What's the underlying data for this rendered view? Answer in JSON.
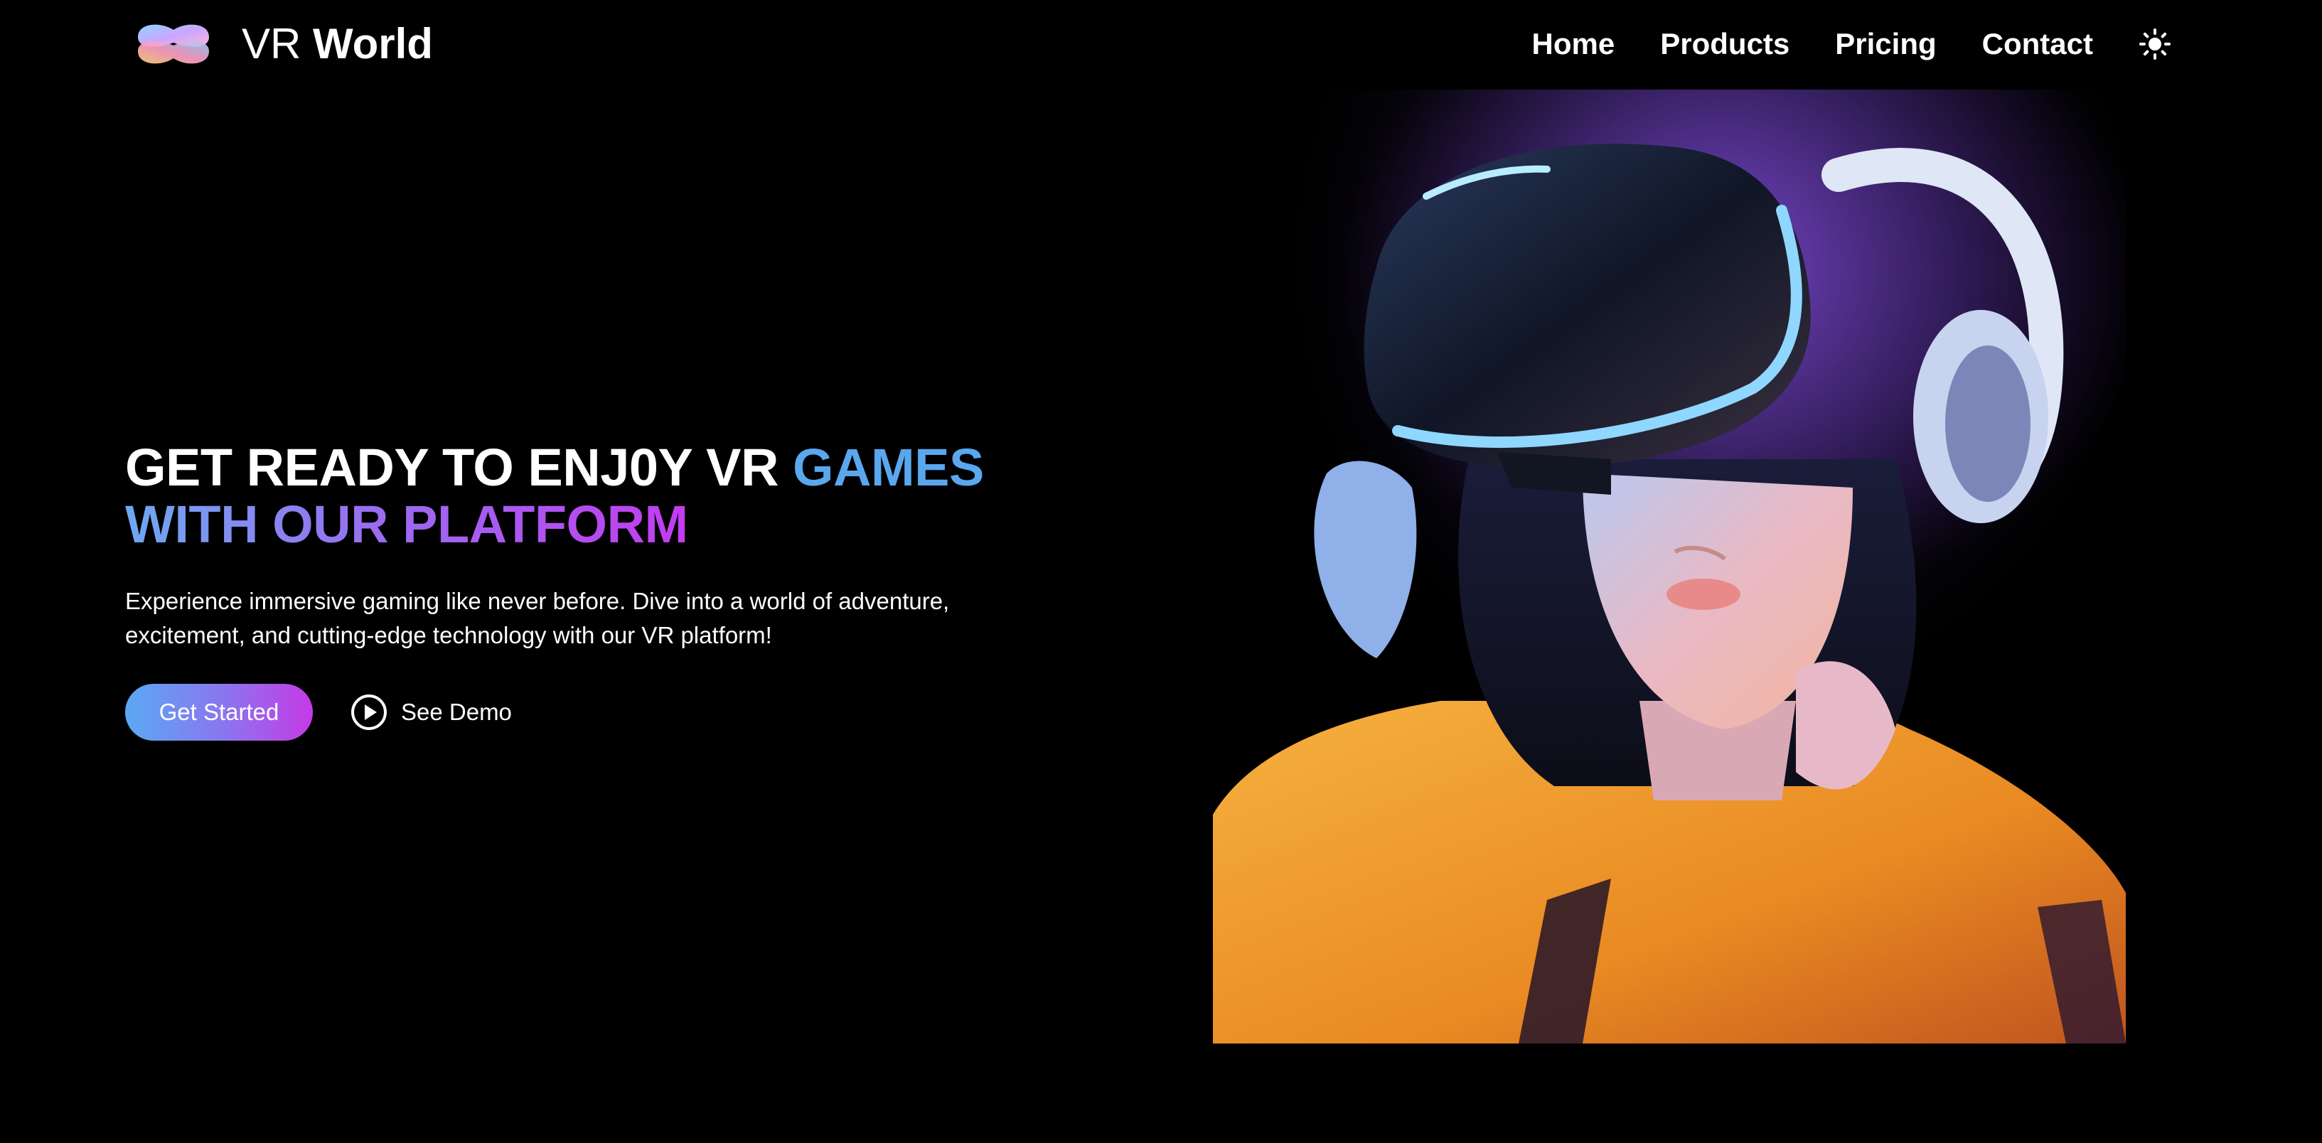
{
  "header": {
    "logo_icon": "vr-headset-logo-icon",
    "brand_light": "VR",
    "brand_bold": "World",
    "nav": [
      {
        "label": "Home"
      },
      {
        "label": "Products"
      },
      {
        "label": "Pricing"
      },
      {
        "label": "Contact"
      }
    ],
    "theme_toggle_icon": "sun-icon"
  },
  "hero": {
    "headline_part1": "GET READY TO ENJ0Y VR ",
    "headline_accent": "GAMES",
    "headline_line2": "WITH OUR PLATFORM",
    "description": "Experience immersive gaming like never before. Dive into a world of adventure, excitement, and cutting-edge technology with our VR platform!",
    "primary_button": "Get Started",
    "secondary_button": "See Demo",
    "secondary_icon": "play-circle-icon",
    "image_subject": "woman-wearing-vr-headset-image"
  },
  "colors": {
    "background": "#000000",
    "accent_blue": "#5aa7ee",
    "accent_purple": "#c23cf0",
    "hoodie_orange": "#f0a030"
  }
}
